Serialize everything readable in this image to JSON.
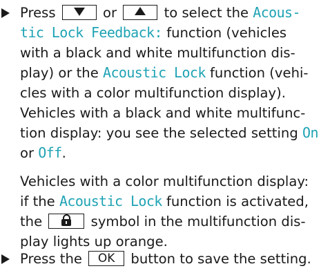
{
  "step1": {
    "marker": "arrow-right",
    "l1_a": "Press",
    "key_down_icon": "triangle-down",
    "l1_b": "or",
    "key_up_icon": "triangle-up",
    "l1_c": "to select the",
    "l1_cyan": "Acous-",
    "l2_cyan": "tic Lock Feedback:",
    "l2_b": "function (vehicles",
    "l3": "with a black and white multifunction dis-",
    "l4_a": "play) or the",
    "l4_cyan": "Acoustic Lock",
    "l4_b": "function (vehi-",
    "l5": "cles with a color multifunction display).",
    "l6": "Vehicles with a black and white multifunc-",
    "l7_a": "tion display: you see the selected setting",
    "l7_cyan": "On",
    "l8_a": "or",
    "l8_cyan": "Off",
    "l8_b": "."
  },
  "para2": {
    "l1": "Vehicles with a color multifunction display:",
    "l2_a": "if the",
    "l2_cyan": "Acoustic Lock",
    "l2_b": "function is activated,",
    "l3_a": "the",
    "key_lock_icon": "lock-icon",
    "l3_b": "symbol in the multifunction dis-",
    "l4": "play lights up orange."
  },
  "step2": {
    "marker": "arrow-right",
    "a": "Press the",
    "ok_label": "OK",
    "b": "button to save the setting."
  },
  "colors": {
    "text": "#1a1a1a",
    "highlight": "#1fa3b4"
  }
}
